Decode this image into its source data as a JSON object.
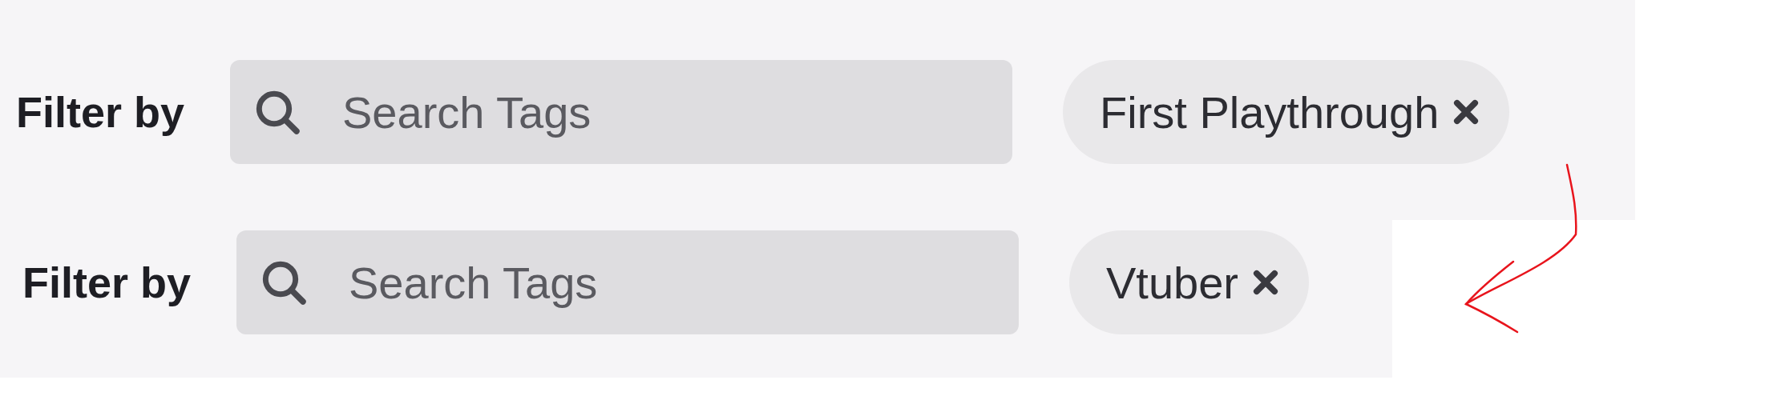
{
  "filters": [
    {
      "label": "Filter by",
      "search": {
        "placeholder": "Search Tags"
      },
      "tags": [
        {
          "label": "First Playthrough"
        }
      ]
    },
    {
      "label": "Filter by",
      "search": {
        "placeholder": "Search Tags"
      },
      "tags": [
        {
          "label": "Vtuber"
        }
      ]
    }
  ]
}
